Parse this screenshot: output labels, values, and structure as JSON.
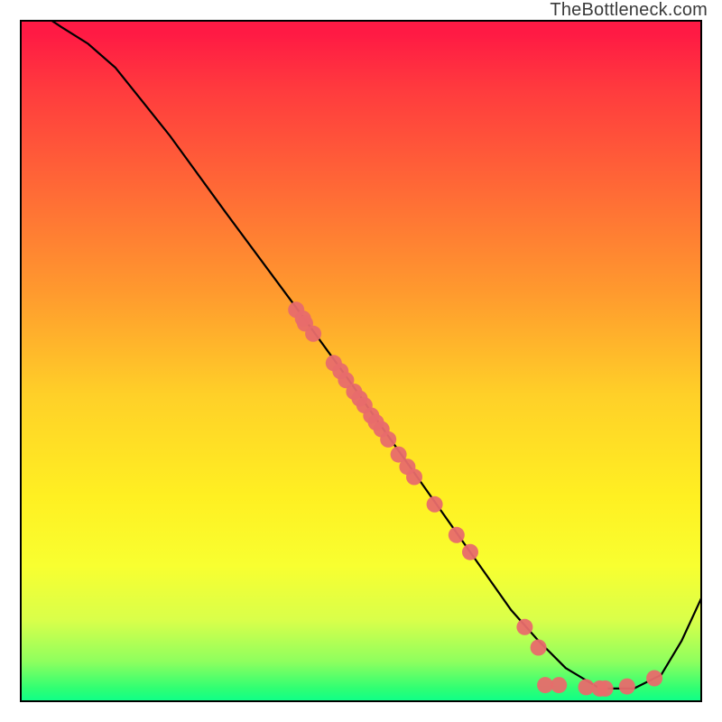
{
  "watermark": "TheBottleneck.com",
  "colors": {
    "curve": "#000000",
    "dots": "#e86c6c",
    "border": "#000000"
  },
  "chart_data": {
    "type": "line",
    "title": "",
    "xlabel": "",
    "ylabel": "",
    "xlim": [
      0,
      1
    ],
    "ylim": [
      0,
      1
    ],
    "series": [
      {
        "name": "curve",
        "x": [
          0.0,
          0.03,
          0.06,
          0.1,
          0.14,
          0.18,
          0.22,
          0.3,
          0.4,
          0.48,
          0.54,
          0.6,
          0.66,
          0.72,
          0.76,
          0.8,
          0.85,
          0.9,
          0.94,
          0.97,
          1.0
        ],
        "y": [
          1.03,
          1.01,
          0.99,
          0.965,
          0.93,
          0.88,
          0.83,
          0.72,
          0.585,
          0.475,
          0.39,
          0.305,
          0.22,
          0.135,
          0.09,
          0.05,
          0.02,
          0.02,
          0.04,
          0.09,
          0.155
        ]
      }
    ],
    "dots": [
      {
        "x": 0.405,
        "y": 0.575
      },
      {
        "x": 0.415,
        "y": 0.562
      },
      {
        "x": 0.418,
        "y": 0.555
      },
      {
        "x": 0.43,
        "y": 0.54
      },
      {
        "x": 0.46,
        "y": 0.497
      },
      {
        "x": 0.47,
        "y": 0.485
      },
      {
        "x": 0.478,
        "y": 0.472
      },
      {
        "x": 0.49,
        "y": 0.455
      },
      {
        "x": 0.498,
        "y": 0.445
      },
      {
        "x": 0.505,
        "y": 0.435
      },
      {
        "x": 0.515,
        "y": 0.42
      },
      {
        "x": 0.522,
        "y": 0.41
      },
      {
        "x": 0.53,
        "y": 0.4
      },
      {
        "x": 0.54,
        "y": 0.385
      },
      {
        "x": 0.555,
        "y": 0.363
      },
      {
        "x": 0.568,
        "y": 0.345
      },
      {
        "x": 0.578,
        "y": 0.33
      },
      {
        "x": 0.608,
        "y": 0.29
      },
      {
        "x": 0.64,
        "y": 0.245
      },
      {
        "x": 0.66,
        "y": 0.22
      },
      {
        "x": 0.74,
        "y": 0.11
      },
      {
        "x": 0.76,
        "y": 0.08
      },
      {
        "x": 0.77,
        "y": 0.025
      },
      {
        "x": 0.79,
        "y": 0.025
      },
      {
        "x": 0.83,
        "y": 0.022
      },
      {
        "x": 0.85,
        "y": 0.02
      },
      {
        "x": 0.858,
        "y": 0.02
      },
      {
        "x": 0.89,
        "y": 0.023
      },
      {
        "x": 0.93,
        "y": 0.035
      }
    ]
  }
}
